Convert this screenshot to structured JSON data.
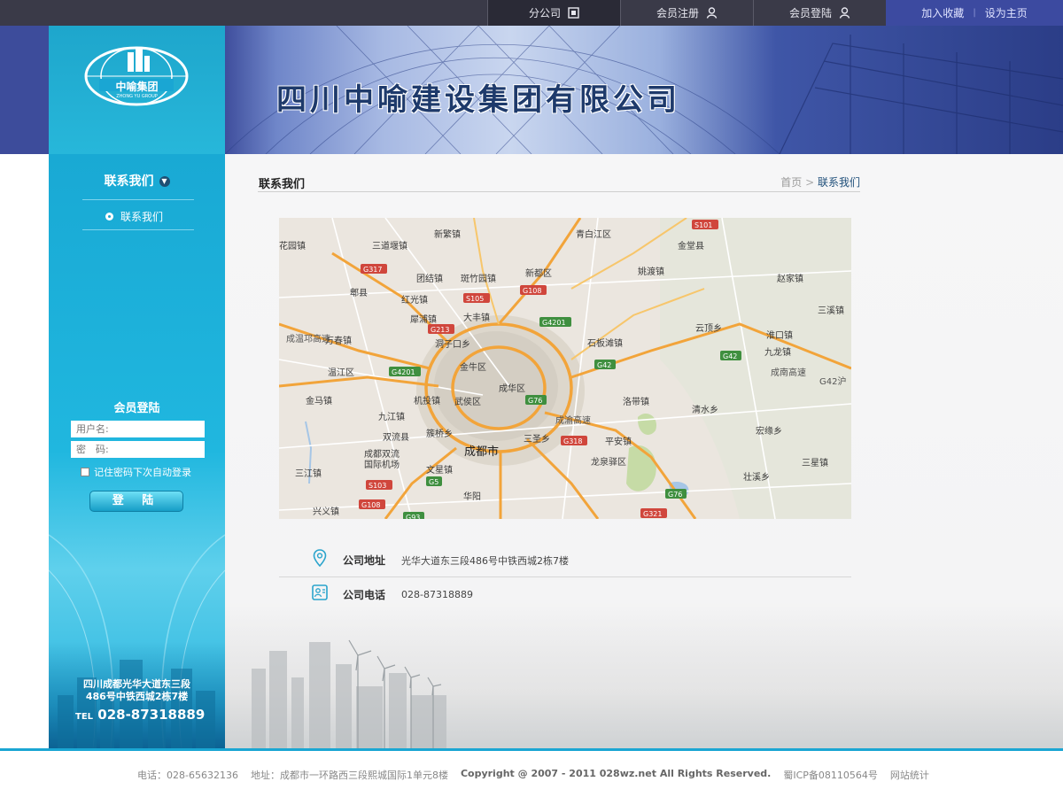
{
  "topbar": {
    "tabs": [
      {
        "label": "分公司",
        "icon": "window-icon"
      },
      {
        "label": "会员注册",
        "icon": "user-icon"
      },
      {
        "label": "会员登陆",
        "icon": "user-icon"
      }
    ],
    "favorite": "加入收藏",
    "separator": "|",
    "homepage": "设为主页"
  },
  "banner": {
    "logo_text": "中喻集团",
    "logo_sub": "ZHONG YU GROUP",
    "company_name": "四川中喻建设集团有限公司"
  },
  "sidebar": {
    "section_title": "联系我们",
    "menu": [
      {
        "label": "联系我们"
      }
    ],
    "login": {
      "title": "会员登陆",
      "username_placeholder": "用户名:",
      "password_placeholder": "密　码:",
      "remember": "记住密码下次自动登录",
      "button": "登 陆"
    },
    "address_line1": "四川成都光华大道东三段",
    "address_line2": "486号中铁西城2栋7楼",
    "tel_prefix": "TEL",
    "tel": "028-87318889"
  },
  "main": {
    "page_title": "联系我们",
    "breadcrumb": {
      "home": "首页",
      "separator": ">",
      "current": "联系我们"
    },
    "map_labels": [
      {
        "text": "青白江区"
      },
      {
        "text": "金堂县"
      },
      {
        "text": "新繁镇"
      },
      {
        "text": "三道堰镇"
      },
      {
        "text": "团结镇"
      },
      {
        "text": "斑竹园镇"
      },
      {
        "text": "新都区"
      },
      {
        "text": "姚渡镇"
      },
      {
        "text": "赵家镇"
      },
      {
        "text": "郫县"
      },
      {
        "text": "红光镇"
      },
      {
        "text": "三溪镇"
      },
      {
        "text": "犀浦镇"
      },
      {
        "text": "大丰镇"
      },
      {
        "text": "云顶乡"
      },
      {
        "text": "淮口镇"
      },
      {
        "text": "万春镇"
      },
      {
        "text": "洞子口乡"
      },
      {
        "text": "石板滩镇"
      },
      {
        "text": "九龙镇"
      },
      {
        "text": "温江区"
      },
      {
        "text": "金牛区"
      },
      {
        "text": "成华区"
      },
      {
        "text": "成南高速"
      },
      {
        "text": "金马镇"
      },
      {
        "text": "机投镇"
      },
      {
        "text": "武侯区"
      },
      {
        "text": "洛带镇"
      },
      {
        "text": "九江镇"
      },
      {
        "text": "清水乡"
      },
      {
        "text": "簇桥乡"
      },
      {
        "text": "成渝高速"
      },
      {
        "text": "宏缘乡"
      },
      {
        "text": "双流县"
      },
      {
        "text": "三圣乡"
      },
      {
        "text": "平安镇"
      },
      {
        "text": "成都市"
      },
      {
        "text": "成都双流"
      },
      {
        "text": "国际机场"
      },
      {
        "text": "龙泉驿区"
      },
      {
        "text": "三星镇"
      },
      {
        "text": "三江镇"
      },
      {
        "text": "文星镇"
      },
      {
        "text": "壮溪乡"
      },
      {
        "text": "华阳"
      },
      {
        "text": "兴义镇"
      },
      {
        "text": "花园镇"
      },
      {
        "text": "成温邛高速"
      },
      {
        "text": "G42沪"
      }
    ],
    "road_shields": [
      {
        "text": "S101"
      },
      {
        "text": "G317"
      },
      {
        "text": "G108"
      },
      {
        "text": "S105"
      },
      {
        "text": "G4201"
      },
      {
        "text": "G213"
      },
      {
        "text": "G42"
      },
      {
        "text": "G42"
      },
      {
        "text": "G4201"
      },
      {
        "text": "G76"
      },
      {
        "text": "G318"
      },
      {
        "text": "G5"
      },
      {
        "text": "S103"
      },
      {
        "text": "G108"
      },
      {
        "text": "G76"
      },
      {
        "text": "G93"
      },
      {
        "text": "G321"
      }
    ],
    "info": [
      {
        "icon": "location-pin-icon",
        "label": "公司地址",
        "value": "光华大道东三段486号中铁西城2栋7楼"
      },
      {
        "icon": "contact-card-icon",
        "label": "公司电话",
        "value": "028-87318889"
      }
    ]
  },
  "footer": {
    "phone": "电话：028-65632136",
    "address": "地址：成都市一环路西三段熙城国际1单元8楼",
    "copyright": "Copyright @ 2007 - 2011 028wz.net All Rights Reserved.",
    "icp": "蜀ICP备08110564号",
    "stats": "网站统计"
  },
  "colors": {
    "accent": "#1aa6d3",
    "topbar": "#3a3a48",
    "topbar_right": "#3c4aa0",
    "title_blue": "#1e3a6b"
  }
}
